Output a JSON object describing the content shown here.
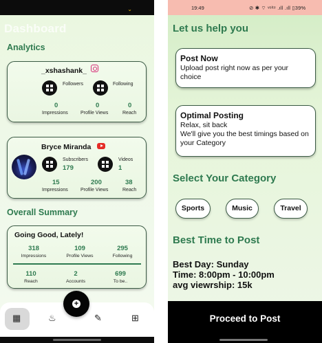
{
  "left": {
    "header_caret": "⌄",
    "ghost_title": "Dashboard",
    "analytics_heading": "Analytics",
    "instagram": {
      "username": "_xshashank_",
      "followers_label": "Followers",
      "following_label": "Following",
      "impressions": "0",
      "profile_views": "0",
      "reach": "0",
      "impressions_label": "Impressions",
      "profile_views_label": "Profile Views",
      "reach_label": "Reach"
    },
    "youtube": {
      "name": "Bryce Miranda",
      "subscribers_label": "Subscribers",
      "subscribers": "179",
      "videos_label": "Videos",
      "videos": "1",
      "impressions": "15",
      "profile_views": "200",
      "reach": "38",
      "impressions_label": "Impressions",
      "profile_views_label": "Profile Views",
      "reach_label": "Reach"
    },
    "summary_heading": "Overall Summary",
    "summary": {
      "title": "Going Good, Lately!",
      "impressions": "318",
      "impressions_label": "Impressions",
      "profile_views": "109",
      "profile_views_label": "Profile Views",
      "following": "295",
      "following_label": "Following",
      "reach": "110",
      "reach_label": "Reach",
      "accounts": "2",
      "accounts_label": "Accounts",
      "to_be": "699",
      "to_be_label": "To be.."
    },
    "fab_symbol": "+",
    "nav_icons": {
      "dashboard": "▦",
      "fire": "♨",
      "magic": "✎",
      "grid": "⊞"
    }
  },
  "right": {
    "status": {
      "time": "19:49",
      "indicators": "⊘ ✱ ⌔ ᵛᵒˡᵗᵉ .ıll .ıll ▯39%"
    },
    "help_heading": "Let us help you",
    "post_now": {
      "title": "Post Now",
      "description": "Upload post right now as per your choice"
    },
    "optimal_posting": {
      "title": "Optimal Posting",
      "description_line1": "Relax, sit back",
      "description_line2": "We'll give you the best timings based on your Category"
    },
    "category_heading": "Select Your Category",
    "categories": [
      "Sports",
      "Music",
      "Travel"
    ],
    "best_time_heading": "Best Time to Post",
    "best_day": "Best Day: Sunday",
    "best_time": "Time: 8:00pm - 10:00pm",
    "avg_viewership": "avg viewrship: 15k",
    "cta_label": "Proceed to Post"
  }
}
